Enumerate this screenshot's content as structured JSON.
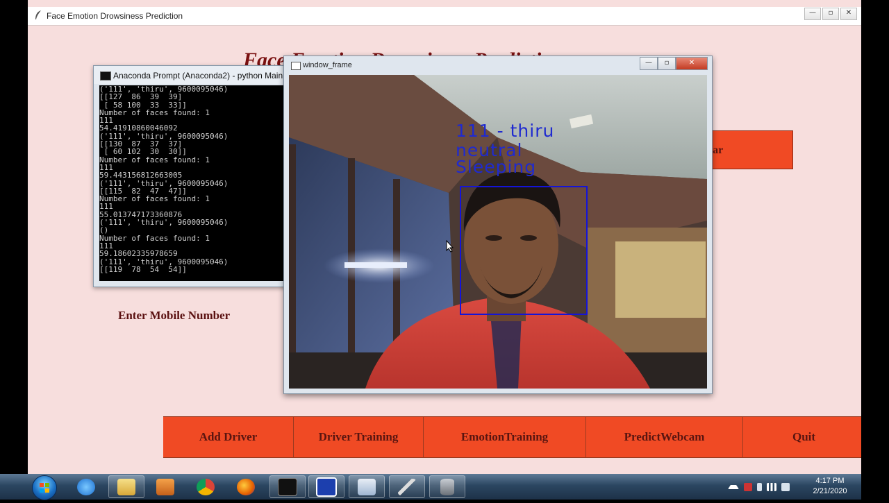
{
  "main_window": {
    "title": "Face Emotion Drowsiness Prediction",
    "app_heading": "Face Emotion Drowsiness Prediction",
    "clear_button_label": "ear",
    "mobile_label": "Enter Mobile Number",
    "window_buttons": {
      "minimize": "—",
      "maximize": "▫",
      "close": "✕"
    }
  },
  "bottom_buttons": [
    {
      "label": "Add Driver"
    },
    {
      "label": "Driver Training"
    },
    {
      "label": "EmotionTraining"
    },
    {
      "label": "PredictWebcam"
    },
    {
      "label": "Quit"
    }
  ],
  "console": {
    "title": "Anaconda Prompt (Anaconda2) - python  Main.py",
    "lines": [
      "('111', 'thiru', 9600095046)",
      "[[127  86  39  39]",
      " [ 58 100  33  33]]",
      "Number of faces found: 1",
      "111",
      "54.41910860046092",
      "('111', 'thiru', 9600095046)",
      "[[130  87  37  37]",
      " [ 60 102  30  30]]",
      "Number of faces found: 1",
      "111",
      "59.443156812663005",
      "('111', 'thiru', 9600095046)",
      "[[115  82  47  47]]",
      "Number of faces found: 1",
      "111",
      "55.013747173360876",
      "('111', 'thiru', 9600095046)",
      "()",
      "Number of faces found: 1",
      "111",
      "59.18602335978659",
      "('111', 'thiru', 9600095046)",
      "[[119  78  54  54]]"
    ]
  },
  "frame_window": {
    "title": "window_frame",
    "overlay_id_name": "111 - thiru",
    "overlay_emotion": "neutral",
    "overlay_state": "Sleeping",
    "window_buttons": {
      "minimize": "—",
      "maximize": "▫",
      "close": "✕"
    }
  },
  "taskbar": {
    "time": "4:17 PM",
    "date": "2/21/2020",
    "apps": [
      "internet-explorer-icon",
      "file-explorer-icon",
      "media-player-icon",
      "chrome-icon",
      "firefox-icon",
      "terminal-icon",
      "window-app-icon",
      "text-editor-icon",
      "python-feather-icon",
      "database-icon"
    ]
  }
}
